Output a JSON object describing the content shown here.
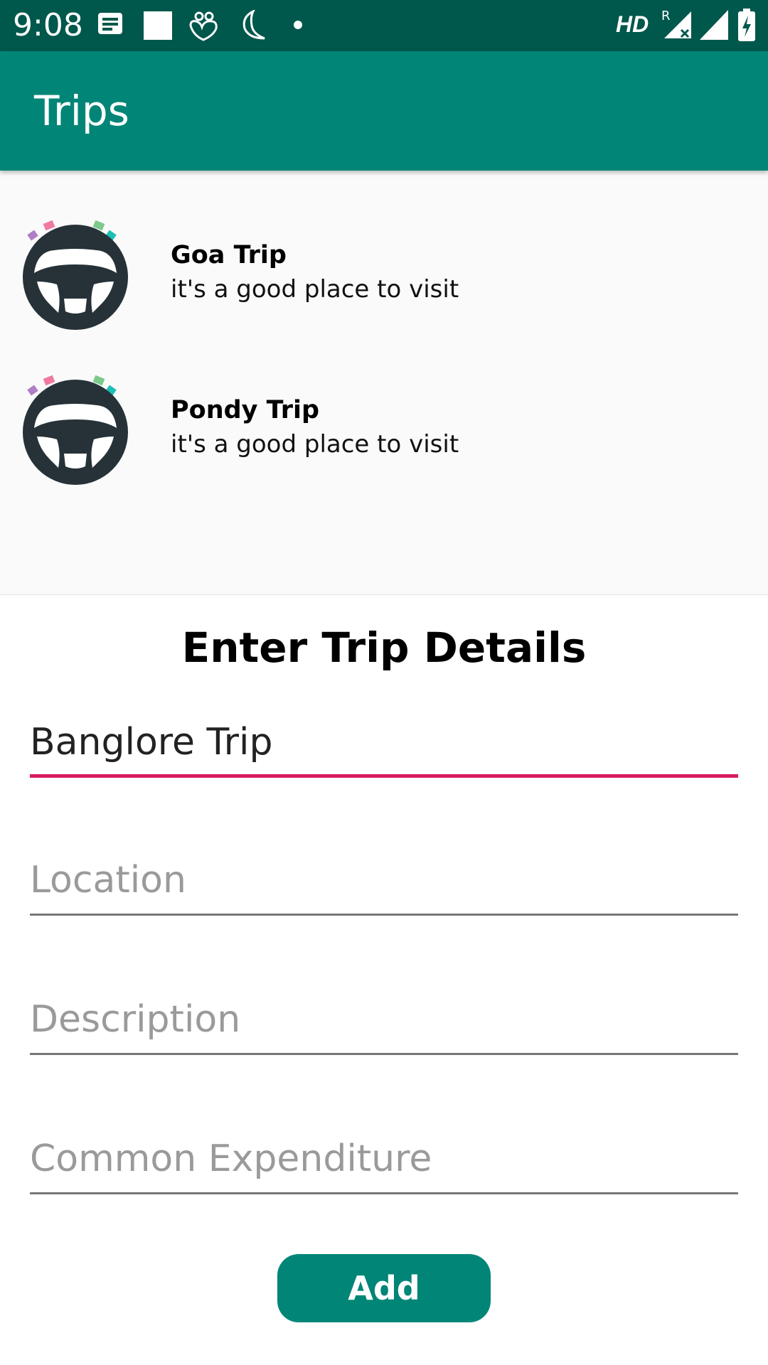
{
  "status_bar": {
    "time": "9:08",
    "network_label": "HD",
    "roaming_label": "R",
    "background_color": "#00574b",
    "icons": [
      "notes-icon",
      "square-icon",
      "hearts-icon",
      "moon-icon",
      "dot-icon",
      "signal-roaming-icon",
      "signal-icon",
      "battery-charging-icon"
    ]
  },
  "app_bar": {
    "title": "Trips",
    "color": "#008577"
  },
  "trips": [
    {
      "name": "Goa Trip",
      "description": "it's a good place to visit",
      "icon": "steering-wheel-icon"
    },
    {
      "name": "Pondy Trip",
      "description": "it's a good place to visit",
      "icon": "steering-wheel-icon"
    }
  ],
  "form": {
    "title": "Enter Trip Details",
    "name_value": "Banglore Trip",
    "location_placeholder": "Location",
    "description_placeholder": "Description",
    "expenditure_placeholder": "Common Expenditure",
    "add_label": "Add",
    "accent_color": "#d81b60"
  }
}
